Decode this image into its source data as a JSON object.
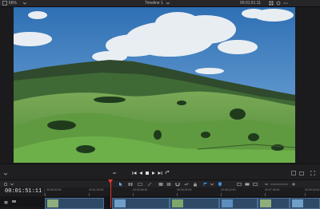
{
  "viewer": {
    "zoom": "66%",
    "title": "Timeline 1",
    "timecode": "00:01:51:11"
  },
  "timeline": {
    "timecode": "00:01:51:11",
    "ruler_labels": [
      "00:00:00:00",
      "00:01:33:00",
      "00:03:06:00",
      "00:04:39:00",
      "00:06:12:00",
      "00:07:45:00",
      "00:09:18:00"
    ]
  },
  "colors": {
    "accent": "#e2372d",
    "clip": "#2f4a66",
    "clip_border": "#4a6f95",
    "sky": "#3d7ab8",
    "grass": "#6aa14a"
  }
}
